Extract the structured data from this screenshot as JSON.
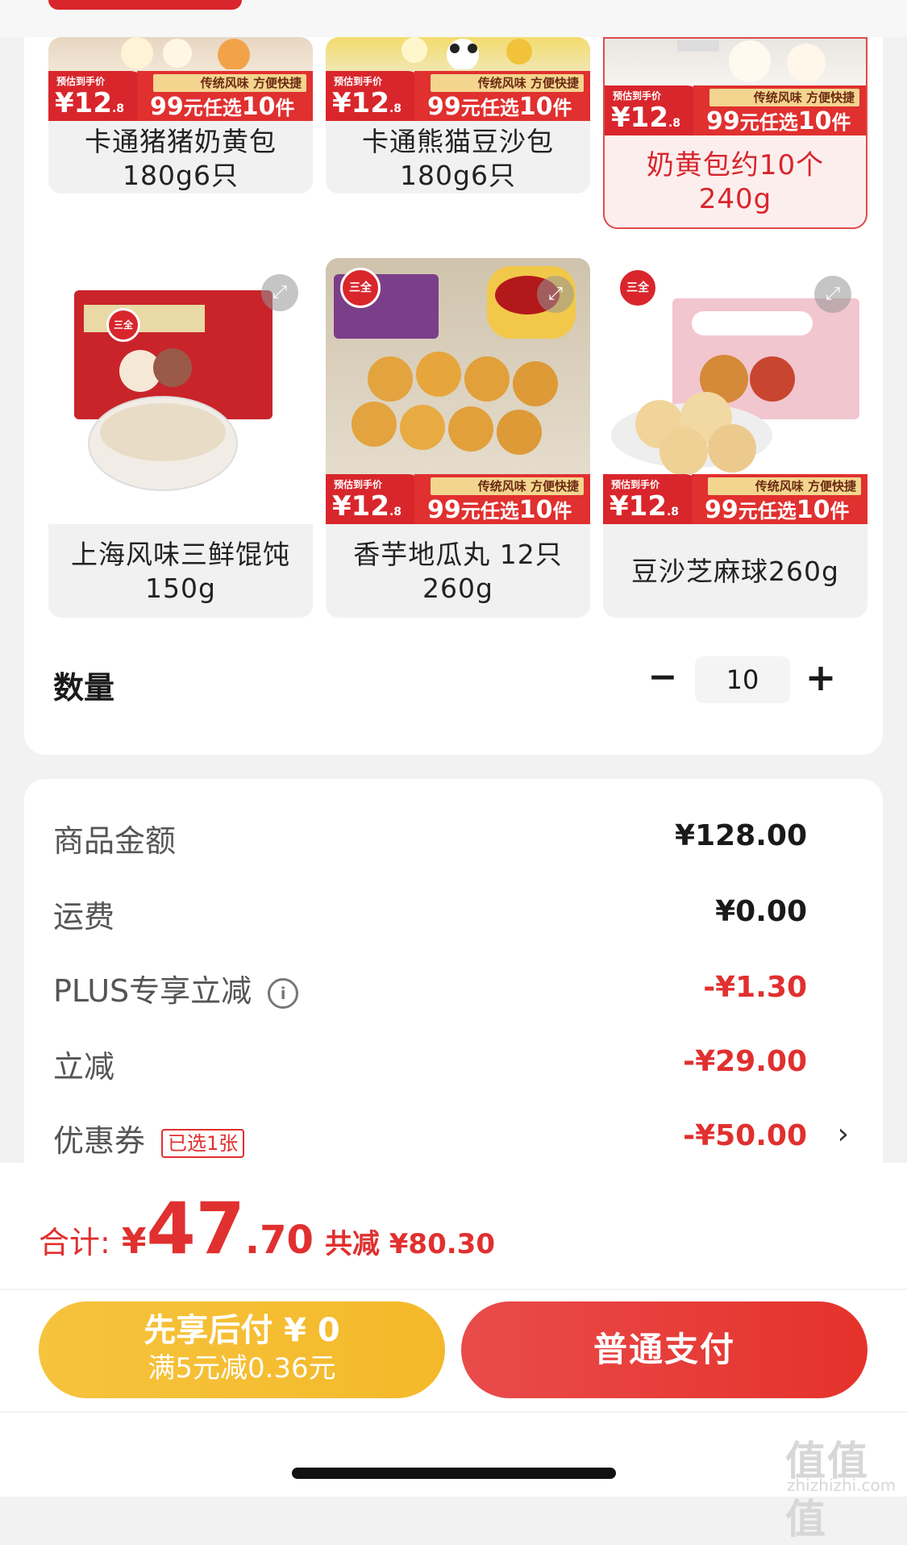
{
  "colors": {
    "accent_red": "#d8262c",
    "price_red": "#e0302f",
    "yellow": "#f6c33d",
    "bg": "#f2f2f2"
  },
  "products": [
    {
      "name": "卡通猪猪奶黄包180g6只",
      "est_label": "预估到手价",
      "price_main": "¥12",
      "price_dec": ".8",
      "tagline": "传统风味 方便快捷",
      "promo_a": "99",
      "promo_b": "元任选",
      "promo_c": "10",
      "promo_d": "件"
    },
    {
      "name": "卡通熊猫豆沙包180g6只",
      "est_label": "预估到手价",
      "price_main": "¥12",
      "price_dec": ".8",
      "tagline": "传统风味 方便快捷",
      "promo_a": "99",
      "promo_b": "元任选",
      "promo_c": "10",
      "promo_d": "件"
    },
    {
      "name": "奶黄包约10个240g",
      "est_label": "预估到手价",
      "price_main": "¥12",
      "price_dec": ".8",
      "tagline": "传统风味 方便快捷",
      "promo_a": "99",
      "promo_b": "元任选",
      "promo_c": "10",
      "promo_d": "件",
      "selected": true
    },
    {
      "name": "上海风味三鲜馄饨150g",
      "brand": "三全"
    },
    {
      "name": "香芋地瓜丸 12只260g",
      "est_label": "预估到手价",
      "price_main": "¥12",
      "price_dec": ".8",
      "tagline": "传统风味 方便快捷",
      "promo_a": "99",
      "promo_b": "元任选",
      "promo_c": "10",
      "promo_d": "件",
      "brand": "三全"
    },
    {
      "name": "豆沙芝麻球260g",
      "est_label": "预估到手价",
      "price_main": "¥12",
      "price_dec": ".8",
      "tagline": "传统风味 方便快捷",
      "promo_a": "99",
      "promo_b": "元任选",
      "promo_c": "10",
      "promo_d": "件",
      "brand": "三全"
    }
  ],
  "quantity": {
    "label": "数量",
    "minus": "−",
    "value": "10",
    "plus": "+"
  },
  "details": [
    {
      "label": "商品金额",
      "value": "¥128.00"
    },
    {
      "label": "运费",
      "value": "¥0.00"
    },
    {
      "label": "PLUS专享立减",
      "value": "-¥1.30",
      "info_icon": "i"
    },
    {
      "label": "立减",
      "value": "-¥29.00"
    },
    {
      "label": "优惠券",
      "tag": "已选1张",
      "value": "-¥50.00",
      "chevron": "›"
    }
  ],
  "footer": {
    "total_label": "合计:",
    "yen": "¥",
    "total_int": "47",
    "total_dec": ".70",
    "saving": "共减 ¥80.30",
    "bnpl_line1": "先享后付 ¥ 0",
    "bnpl_line2": "满5元减0.36元",
    "pay_button": "普通支付"
  },
  "watermark": {
    "text": "值值值",
    "sub": "zhizhizhi.com"
  }
}
